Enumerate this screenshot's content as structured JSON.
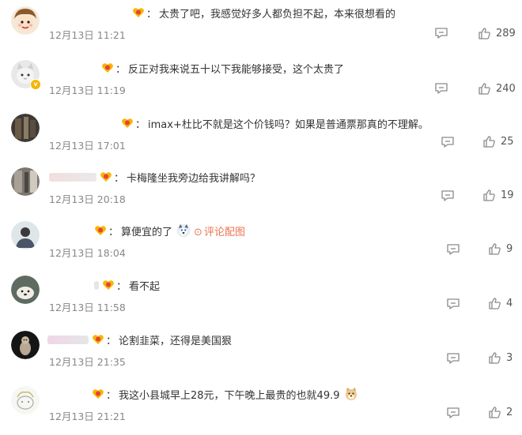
{
  "colors": {
    "text": "#333333",
    "time": "#888888",
    "icon": "#8a8a8a",
    "badge": "#f7b500",
    "link": "#eb7350"
  },
  "comments": [
    {
      "avatar_icon": "cartoon-girl-avatar-icon",
      "fan_badge_icon": "fan-heart-badge-icon",
      "text": "太贵了吧，我感觉好多人都负担不起，本来很想看的",
      "time": "12月13日 11:21",
      "likes": "289"
    },
    {
      "avatar_icon": "cat-avatar-icon",
      "fan_badge_icon": "fan-heart-badge-icon",
      "verified_badge": "v",
      "text": "反正对我来说五十以下我能够接受，这个太贵了",
      "time": "12月13日 11:19",
      "likes": "240"
    },
    {
      "avatar_icon": "photo-avatar-icon",
      "fan_badge_icon": "fan-heart-badge-icon",
      "text": "imax+杜比不就是这个价钱吗？如果是普通票那真的不理解。",
      "time": "12月13日 17:01",
      "likes": "25"
    },
    {
      "avatar_icon": "photo-avatar-icon",
      "fan_badge_icon": "fan-heart-badge-icon",
      "text": "卡梅隆坐我旁边给我讲解吗？",
      "time": "12月13日 20:18",
      "likes": "19"
    },
    {
      "avatar_icon": "person-avatar-icon",
      "fan_badge_icon": "fan-heart-badge-icon",
      "text": "算便宜的了",
      "emoji_icon": "husky-emoji-icon",
      "link_icon": "image-link-icon",
      "link_text": "评论配图",
      "time": "12月13日 18:04",
      "likes": "9"
    },
    {
      "avatar_icon": "dog-avatar-icon",
      "fan_badge_icon": "fan-heart-badge-icon",
      "text": "看不起",
      "time": "12月13日 11:58",
      "likes": "4"
    },
    {
      "avatar_icon": "animal-avatar-icon",
      "fan_badge_icon": "fan-heart-badge-icon",
      "text": "论割韭菜，还得是美国狠",
      "time": "12月13日 21:35",
      "likes": "3"
    },
    {
      "avatar_icon": "sketch-avatar-icon",
      "fan_badge_icon": "fan-heart-badge-icon",
      "text": "我这小县城早上28元，下午晚上最贵的也就49.9",
      "emoji_icon": "doge-emoji-icon",
      "time": "12月13日 21:21",
      "likes": "2"
    }
  ]
}
